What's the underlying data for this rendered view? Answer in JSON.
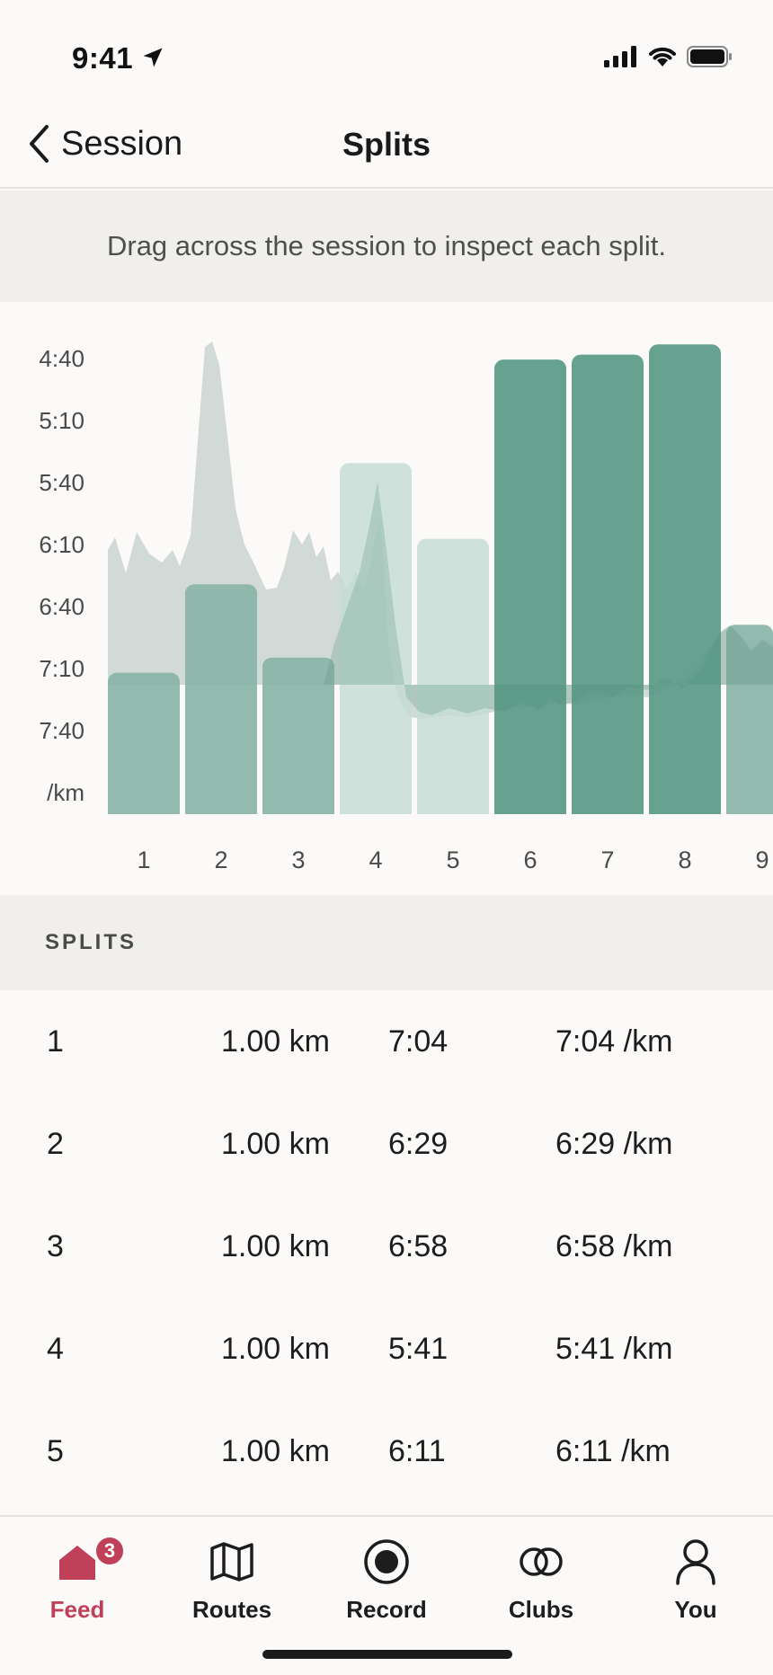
{
  "status": {
    "time": "9:41"
  },
  "nav": {
    "back_label": "Session",
    "title": "Splits"
  },
  "hint": "Drag across the session to inspect each split.",
  "chart_data": {
    "type": "bar",
    "categories": [
      "1",
      "2",
      "3",
      "4",
      "5",
      "6",
      "7",
      "8",
      "9"
    ],
    "values": [
      7.067,
      6.483,
      6.967,
      5.683,
      6.183,
      5.0,
      4.967,
      4.9,
      6.75
    ],
    "y_axis": {
      "labels": [
        "4:40",
        "5:10",
        "5:40",
        "6:10",
        "6:40",
        "7:10",
        "7:40"
      ],
      "unit": "/km",
      "top": 4.667,
      "bottom": 8.0,
      "inverted": true
    },
    "colors": {
      "dark": "#5a9a88",
      "medium": "#8ab4a7",
      "light": "#c6dcd5",
      "elevation": "#c9d3d0"
    }
  },
  "splits_header": "SPLITS",
  "splits": [
    {
      "index": "1",
      "distance": "1.00 km",
      "time": "7:04",
      "pace": "7:04 /km"
    },
    {
      "index": "2",
      "distance": "1.00 km",
      "time": "6:29",
      "pace": "6:29 /km"
    },
    {
      "index": "3",
      "distance": "1.00 km",
      "time": "6:58",
      "pace": "6:58 /km"
    },
    {
      "index": "4",
      "distance": "1.00 km",
      "time": "5:41",
      "pace": "5:41 /km"
    },
    {
      "index": "5",
      "distance": "1.00 km",
      "time": "6:11",
      "pace": "6:11 /km"
    }
  ],
  "tabs": [
    {
      "label": "Feed",
      "icon": "home-icon",
      "badge": "3",
      "active": true
    },
    {
      "label": "Routes",
      "icon": "map-icon"
    },
    {
      "label": "Record",
      "icon": "record-icon"
    },
    {
      "label": "Clubs",
      "icon": "clubs-icon"
    },
    {
      "label": "You",
      "icon": "profile-icon"
    }
  ],
  "accent": "#c0405a"
}
